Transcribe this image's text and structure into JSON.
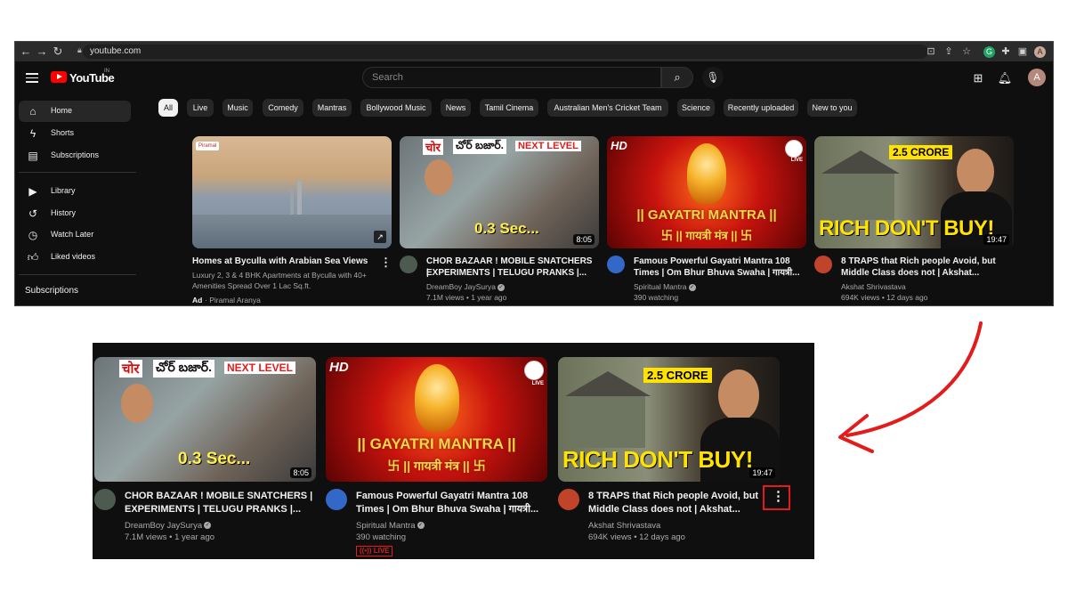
{
  "browser": {
    "url": "youtube.com",
    "icons": [
      "back-icon",
      "forward-icon",
      "reload-icon",
      "lock-icon",
      "install-icon",
      "share-icon",
      "star-icon",
      "grammarly-icon",
      "extensions-icon",
      "sidepanel-icon",
      "profile-icon"
    ],
    "profile_initial": "A"
  },
  "header": {
    "logo_text": "YouTube",
    "region": "IN",
    "search_placeholder": "Search",
    "avatar_initial": "A"
  },
  "sidebar": {
    "items": [
      {
        "label": "Home",
        "icon": "home-icon",
        "active": true
      },
      {
        "label": "Shorts",
        "icon": "shorts-icon"
      },
      {
        "label": "Subscriptions",
        "icon": "subscriptions-icon"
      },
      {
        "label": "Library",
        "icon": "library-icon"
      },
      {
        "label": "History",
        "icon": "history-icon"
      },
      {
        "label": "Watch Later",
        "icon": "watch-later-icon"
      },
      {
        "label": "Liked videos",
        "icon": "liked-videos-icon"
      }
    ],
    "subscriptions_heading": "Subscriptions"
  },
  "chips": [
    "All",
    "Live",
    "Music",
    "Comedy",
    "Mantras",
    "Bollywood Music",
    "News",
    "Tamil Cinema",
    "Australian Men's Cricket Team",
    "Science",
    "Recently uploaded",
    "New to you"
  ],
  "videos": [
    {
      "title_line1": "Homes at Byculla with Arabian Sea Views",
      "desc_line1": "Luxury 2, 3 & 4 BHK Apartments at Byculla with 40+",
      "desc_line2": "Amenities Spread Over 1 Lac Sq.ft.",
      "ad_label": "Ad",
      "advertiser": "· Piramal Aranya",
      "brand_left": "Piramal",
      "kebab": "⋮"
    },
    {
      "title_line1": "CHOR BAZAAR ! MOBILE SNATCHERS |",
      "title_line2": "EXPERIMENTS | TELUGU PRANKS |...",
      "channel": "DreamBoy JaySurya",
      "meta": "7.1M views • 1 year ago",
      "duration": "8:05",
      "cap_chor": "चोर",
      "cap_telugu": "చోర్ బజార్.",
      "cap_next": "NEXT LEVEL",
      "cap_sec": "0.3 Sec..."
    },
    {
      "title_line1": "Famous Powerful Gayatri Mantra 108",
      "title_line2": "Times | Om Bhur Bhuva Swaha | गायत्री...",
      "channel": "Spiritual Mantra",
      "meta": "390 watching",
      "live_label": "LIVE",
      "cap_hd": "HD",
      "cap_main": "|| GAYATRI MANTRA ||",
      "cap_sub": "卐 || गायत्री मंत्र || 卐"
    },
    {
      "title_line1": "8 TRAPS that Rich people Avoid, but",
      "title_line2": "Middle Class does not | Akshat...",
      "channel": "Akshat Shrivastava",
      "meta": "694K views • 12 days ago",
      "duration": "19:47",
      "cap_crore": "2.5 CRORE",
      "cap_rich": "RICH DON'T BUY!",
      "kebab": "⋮"
    }
  ],
  "colors": {
    "youtube_red": "#ff0000",
    "dark_bg": "#0f0f0f",
    "highlight_red": "#e21b1b"
  }
}
